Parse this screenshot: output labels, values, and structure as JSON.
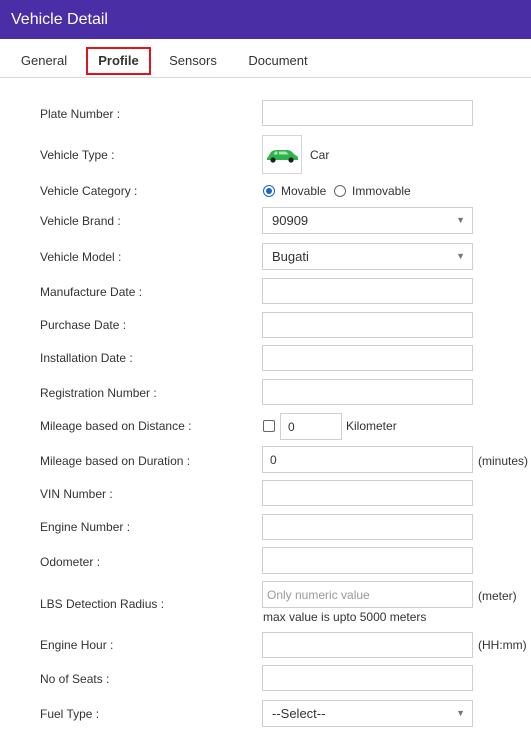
{
  "window": {
    "title": "Vehicle Detail"
  },
  "tabs": [
    {
      "label": "General"
    },
    {
      "label": "Profile",
      "active": true
    },
    {
      "label": "Sensors"
    },
    {
      "label": "Document"
    }
  ],
  "form": {
    "plate_number": {
      "label": "Plate Number :",
      "value": ""
    },
    "vehicle_type": {
      "label": "Vehicle Type :",
      "value": "Car",
      "icon": "car-icon",
      "icon_color": "#2db34a"
    },
    "vehicle_category": {
      "label": "Vehicle Category :",
      "options": [
        "Movable",
        "Immovable"
      ],
      "selected": "Movable"
    },
    "vehicle_brand": {
      "label": "Vehicle Brand :",
      "value": "90909"
    },
    "vehicle_model": {
      "label": "Vehicle Model :",
      "value": "Bugati"
    },
    "manufacture_date": {
      "label": "Manufacture Date :",
      "value": ""
    },
    "purchase_date": {
      "label": "Purchase Date :",
      "value": ""
    },
    "installation_date": {
      "label": "Installation Date :",
      "value": ""
    },
    "registration_number": {
      "label": "Registration Number :",
      "value": ""
    },
    "mileage_distance": {
      "label": "Mileage based on Distance :",
      "checked": false,
      "value": "0",
      "unit": "Kilometer"
    },
    "mileage_duration": {
      "label": "Mileage based on Duration :",
      "value": "0",
      "unit": "(minutes)"
    },
    "vin_number": {
      "label": "VIN Number :",
      "value": ""
    },
    "engine_number": {
      "label": "Engine Number :",
      "value": ""
    },
    "odometer": {
      "label": "Odometer :",
      "value": ""
    },
    "lbs_radius": {
      "label": "LBS Detection Radius :",
      "placeholder": "Only numeric value",
      "unit": "(meter)",
      "hint": "max value is upto 5000 meters"
    },
    "engine_hour": {
      "label": "Engine Hour :",
      "value": "",
      "unit": "(HH:mm)"
    },
    "no_of_seats": {
      "label": "No of Seats :",
      "value": ""
    },
    "fuel_type": {
      "label": "Fuel Type :",
      "value": "--Select--"
    }
  },
  "colors": {
    "titlebar": "#4a2ea6",
    "active_tab_border": "#e0141e",
    "radio_accent": "#1a63d6"
  }
}
